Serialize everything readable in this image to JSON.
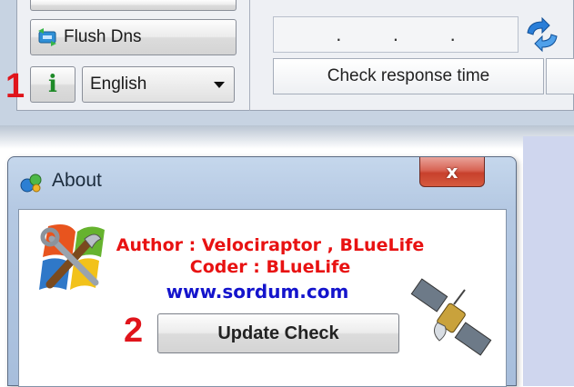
{
  "main_window": {
    "flush_dns_label": "Flush Dns",
    "info_button_glyph": "i",
    "language": {
      "selected": "English"
    },
    "dns_ip_value": [
      ".",
      ".",
      "."
    ],
    "column_header": "Check response time",
    "step_marker": "1"
  },
  "about_dialog": {
    "title": "About",
    "close_glyph": "x",
    "author_line": "Author : Velociraptor , BLueLife",
    "coder_line": "Coder  : BLueLife",
    "website": "www.sordum.com",
    "update_button_label": "Update Check",
    "step_marker": "2"
  },
  "colors": {
    "accent_red": "#e81212",
    "link_blue": "#1414cc",
    "marker_red": "#e0141b"
  },
  "icons": [
    "flush-dns-icon",
    "info-icon",
    "refresh-icon",
    "app-icon",
    "close-icon",
    "tools-logo-icon",
    "satellite-icon"
  ]
}
